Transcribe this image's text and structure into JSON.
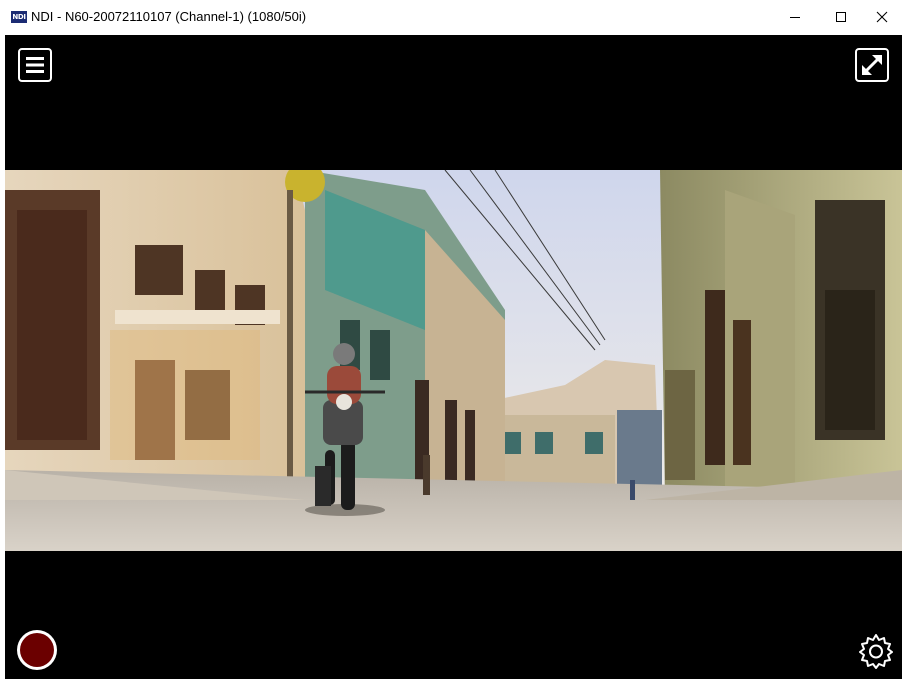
{
  "window": {
    "app_icon_text": "NDI",
    "title": "NDI - N60-20072110107 (Channel-1) (1080/50i)",
    "controls": [
      "minimize-icon",
      "maximize-icon",
      "close-icon"
    ]
  },
  "overlay": {
    "menu_icon": "hamburger-menu-icon",
    "fullscreen_icon": "expand-arrows-icon",
    "record_icon": "record-icon",
    "settings_icon": "gear-icon"
  },
  "colors": {
    "titlebar": "#ffffff",
    "viewport_bg": "#000000",
    "record_fill": "#6b0000",
    "overlay_fg": "#ffffff"
  }
}
